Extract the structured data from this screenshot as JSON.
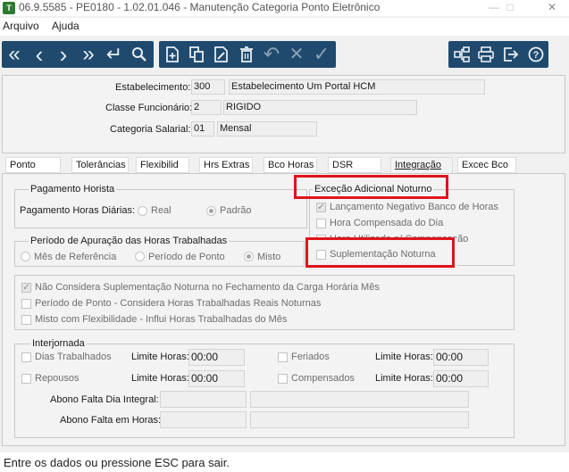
{
  "window": {
    "title": "06.9.5585 - PE0180 - 1.02.01.046 - Manutenção Categoria Ponto Eletrônico",
    "icon_letter": "T",
    "minimize": "—",
    "maximize": "□",
    "close": "✕"
  },
  "menu": {
    "items": [
      "Arquivo",
      "Ajuda"
    ]
  },
  "toolbar": {
    "nav_icons": [
      "first-icon",
      "previous-icon",
      "next-icon",
      "last-icon",
      "return-icon",
      "search-icon"
    ],
    "edit_icons": [
      "new-icon",
      "copy-icon",
      "edit-icon",
      "delete-icon",
      "undo-icon",
      "cancel-icon",
      "confirm-icon"
    ],
    "util_icons": [
      "structure-icon",
      "print-icon",
      "exit-icon",
      "help-icon"
    ],
    "glyphs": {
      "first": "«",
      "previous": "‹",
      "next": "›",
      "last": "»",
      "return": "↵",
      "search": "⌕",
      "undo": "↶",
      "cancel": "✕",
      "confirm": "✓",
      "help": "?"
    },
    "color": "#1f4a6e"
  },
  "header": {
    "estabelecimento": {
      "label": "Estabelecimento:",
      "code": "300",
      "description": "Estabelecimento Um Portal HCM"
    },
    "classe": {
      "label": "Classe Funcionário:",
      "code": "2",
      "description": "RIGIDO"
    },
    "categoria": {
      "label": "Categoria Salarial:",
      "code": "01",
      "description": "Mensal"
    }
  },
  "tabs": [
    "Ponto",
    "Tolerâncias",
    "Flexibilid",
    "Hrs Extras",
    "Bco Horas",
    "DSR",
    "Integração",
    "Excec Bco"
  ],
  "active_tab": "Integração",
  "pagamento_horista": {
    "title": "Pagamento Horista",
    "label": "Pagamento Horas Diárias:",
    "options": [
      "Real",
      "Padrão"
    ],
    "selected": "Padrão"
  },
  "excecao": {
    "title": "Exceção Adicional Noturno",
    "items": [
      {
        "label": "Lançamento Negativo Banco de Horas",
        "checked": true
      },
      {
        "label": "Hora Compensada do Dia",
        "checked": false
      },
      {
        "label": "Hora Utilizada p/ Compensação",
        "checked": false
      },
      {
        "label": "Suplementação Noturna",
        "checked": false
      }
    ]
  },
  "periodo_apuracao": {
    "title": "Período de Apuração das Horas Trabalhadas",
    "options": [
      "Mês de Referência",
      "Período de Ponto",
      "Misto"
    ],
    "selected": "Misto"
  },
  "opcoes": [
    {
      "label": "Não Considera Suplementação Noturna no Fechamento da Carga Horária Mês",
      "checked": true
    },
    {
      "label": "Período de Ponto - Considera Horas Trabalhadas Reais Noturnas",
      "checked": false
    },
    {
      "label": "Misto com Flexibilidade - Influi Horas Trabalhadas do Mês",
      "checked": false
    }
  ],
  "interjornada": {
    "title": "Interjornada",
    "rows": [
      {
        "left_label": "Dias Trabalhados",
        "left_limit_label": "Limite Horas:",
        "left_limit": "00:00",
        "right_label": "Feriados",
        "right_limit_label": "Limite Horas:",
        "right_limit": "00:00"
      },
      {
        "left_label": "Repousos",
        "left_limit_label": "Limite Horas:",
        "left_limit": "00:00",
        "right_label": "Compensados",
        "right_limit_label": "Limite Horas:",
        "right_limit": "00:00"
      }
    ],
    "abono_integral_label": "Abono Falta Dia Integral:",
    "abono_horas_label": "Abono Falta em Horas:"
  },
  "status": {
    "text": "Entre os dados ou pressione ESC para sair."
  },
  "highlight_color": "#e0141c"
}
